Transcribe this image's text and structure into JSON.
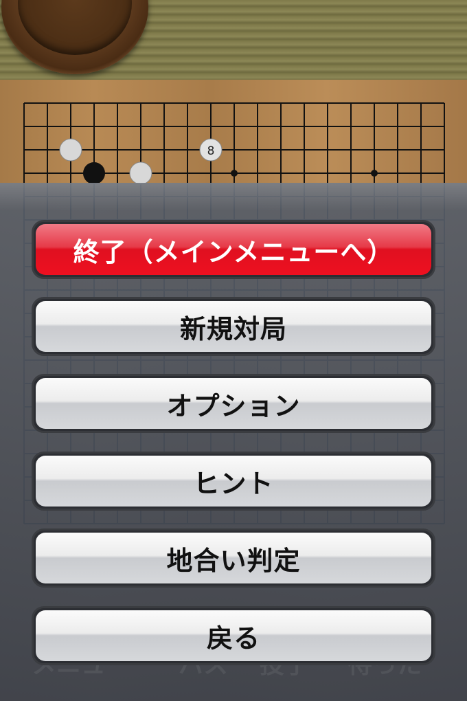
{
  "board": {
    "stone_label": "8"
  },
  "menu": {
    "items": [
      {
        "label": "終了（メインメニューへ）",
        "style": "red"
      },
      {
        "label": "新規対局",
        "style": "normal"
      },
      {
        "label": "オプション",
        "style": "normal"
      },
      {
        "label": "ヒント",
        "style": "normal"
      },
      {
        "label": "地合い判定",
        "style": "normal"
      },
      {
        "label": "戻る",
        "style": "normal"
      }
    ]
  },
  "footer_ghost": [
    "メニュー",
    "パス",
    "投了",
    "待った"
  ],
  "colors": {
    "danger": "#e01020",
    "button_face": "#ececec",
    "overlay": "#3b3f47"
  }
}
